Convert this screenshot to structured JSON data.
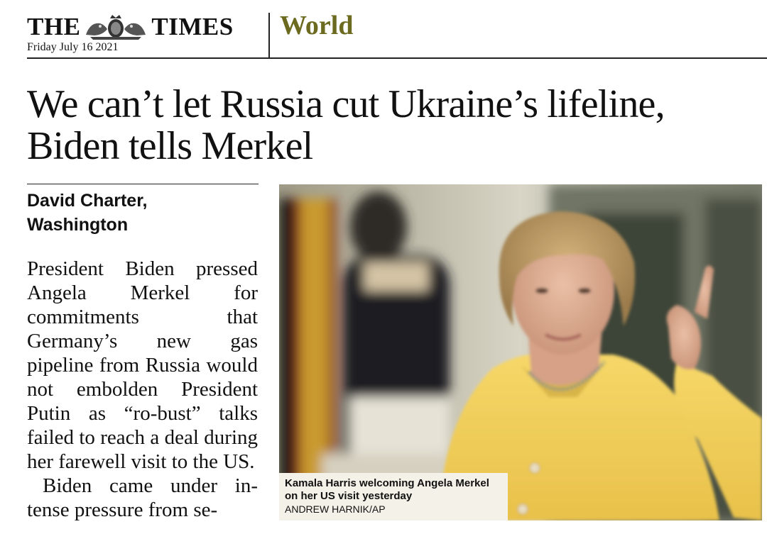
{
  "masthead": {
    "paper_name_left": "THE",
    "paper_name_right": "TIMES",
    "date": "Friday July 16 2021",
    "section": "World",
    "crest_icon": "royal-crest-icon"
  },
  "article": {
    "headline": "We can’t let Russia cut Ukraine’s lifeline, Biden tells Merkel",
    "byline_name": "David Charter,",
    "byline_location": "Washington",
    "paragraphs": [
      "President Biden pressed Angela Merkel for commitments that Germany’s new gas pipeline from Russia would not embolden President Putin as “ro-bust” talks failed to reach a deal during her farewell visit to the US.",
      "Biden came under in-tense pressure from se-"
    ]
  },
  "photo": {
    "caption": "Kamala Harris welcoming Angela Merkel on her US visit yesterday",
    "credit": "ANDREW HARNIK/AP"
  },
  "colors": {
    "section_accent": "#6b6a1e",
    "jacket_yellow": "#f2cd55",
    "caption_bg": "#f3f1e8"
  }
}
